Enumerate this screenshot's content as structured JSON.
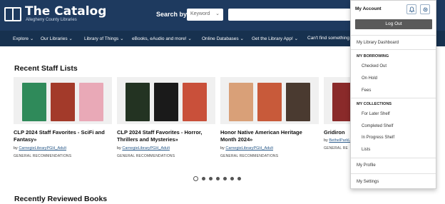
{
  "header": {
    "logo_title": "The Catalog",
    "logo_subtitle": "Allegheny County Libraries",
    "search_label": "Search by",
    "search_select_value": "Keyword"
  },
  "nav": {
    "items": [
      "Explore",
      "Our Libraries",
      "Library of Things",
      "eBooks, eAudio and more!",
      "Online Databases",
      "Get the Library App!",
      "Can't find something"
    ]
  },
  "main": {
    "staff_lists_title": "Recent Staff Lists",
    "reviewed_title": "Recently Reviewed Books",
    "cards": [
      {
        "title": "CLP 2024 Staff Favorites - SciFi and Fantasy",
        "by": "by",
        "author": "CarnegieLibraryPGH_Adult",
        "tag": "GENERAL RECOMMENDATIONS"
      },
      {
        "title": "CLP 2024 Staff Favorites - Horror, Thrillers and Mysteries",
        "by": "by",
        "author": "CarnegieLibraryPGH_Adult",
        "tag": "GENERAL RECOMMENDATIONS"
      },
      {
        "title": "Honor Native American Heritage Month 2024",
        "by": "by",
        "author": "CarnegieLibraryPGH_Adult",
        "tag": "GENERAL RECOMMENDATIONS"
      },
      {
        "title": "Gridiron",
        "by": "by",
        "author": "BethelParkL",
        "tag": "GENERAL RE"
      }
    ],
    "carousel_pages": 7,
    "carousel_active": 1
  },
  "account_menu": {
    "title": "My Account",
    "logout": "Log Out",
    "dashboard": "My Library Dashboard",
    "borrowing_header": "MY BORROWING",
    "checked_out": "Checked Out",
    "on_hold": "On Hold",
    "fees": "Fees",
    "collections_header": "MY COLLECTIONS",
    "for_later": "For Later Shelf",
    "completed": "Completed Shelf",
    "in_progress": "In Progress Shelf",
    "lists": "Lists",
    "profile": "My Profile",
    "settings": "My Settings"
  },
  "colors": {
    "header_bg": "#1e3a5f",
    "nav_bg": "#17314f",
    "link": "#2a5a8a"
  },
  "icons": [
    "book-icon",
    "chevron-down-icon",
    "bell-icon",
    "gear-icon",
    "chevron-right-icon"
  ]
}
